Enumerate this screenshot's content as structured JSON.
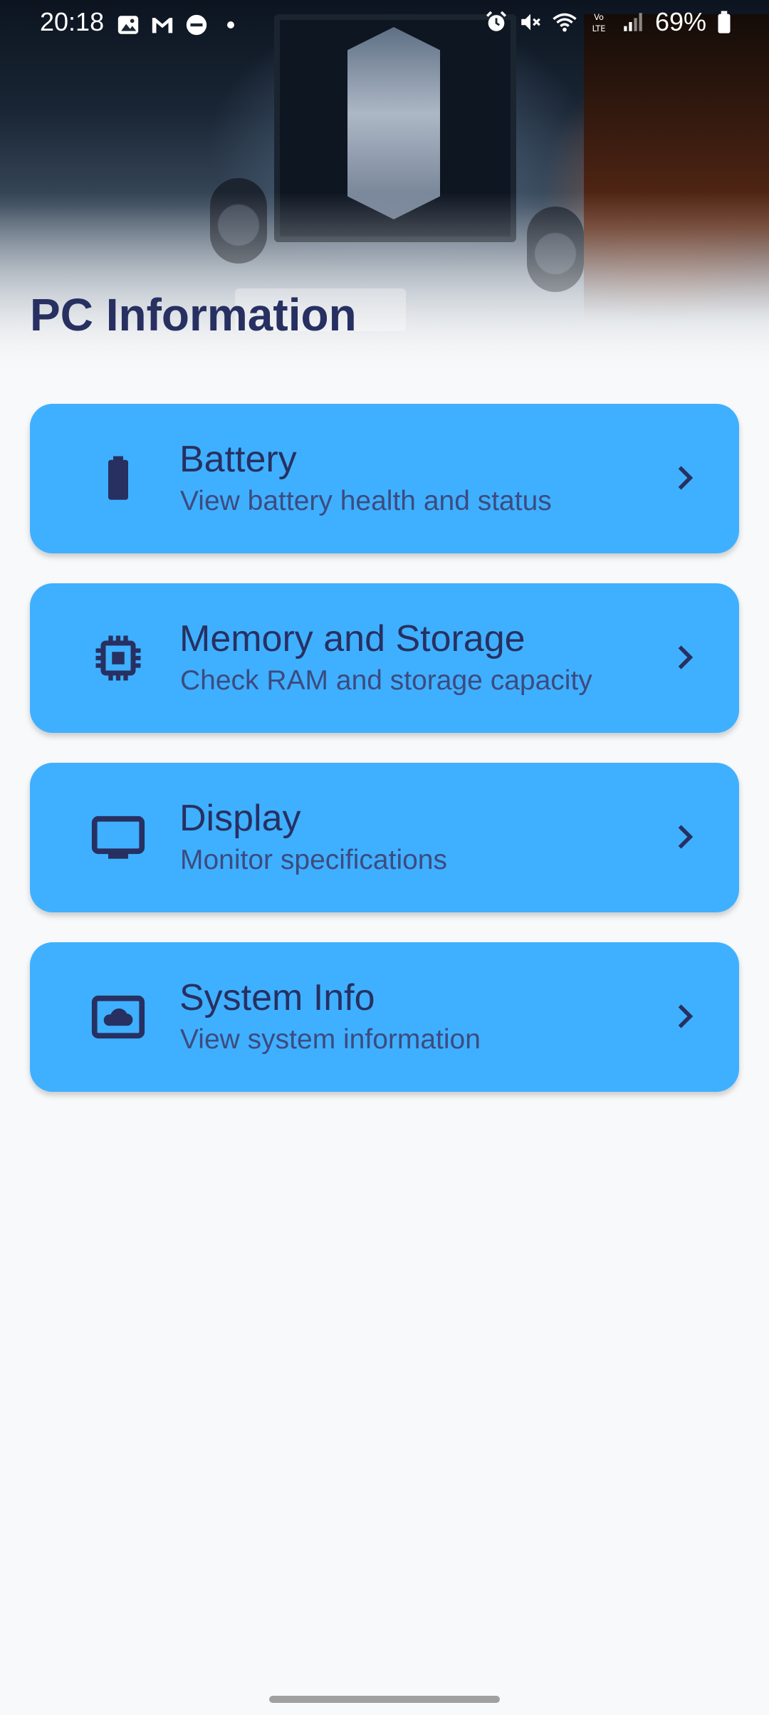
{
  "status_bar": {
    "time": "20:18",
    "battery_percent": "69%"
  },
  "header": {
    "title": "PC Information"
  },
  "cards": [
    {
      "title": "Battery",
      "subtitle": "View battery health and status",
      "icon": "battery-icon"
    },
    {
      "title": "Memory and Storage",
      "subtitle": "Check RAM and storage capacity",
      "icon": "memory-chip-icon"
    },
    {
      "title": "Display",
      "subtitle": "Monitor specifications",
      "icon": "monitor-icon"
    },
    {
      "title": "System Info",
      "subtitle": "View system information",
      "icon": "cloud-screen-icon"
    }
  ],
  "colors": {
    "card_background": "#3fb0ff",
    "text_primary": "#273061",
    "text_secondary": "#3c4b80",
    "page_background": "#f8f9fa"
  }
}
